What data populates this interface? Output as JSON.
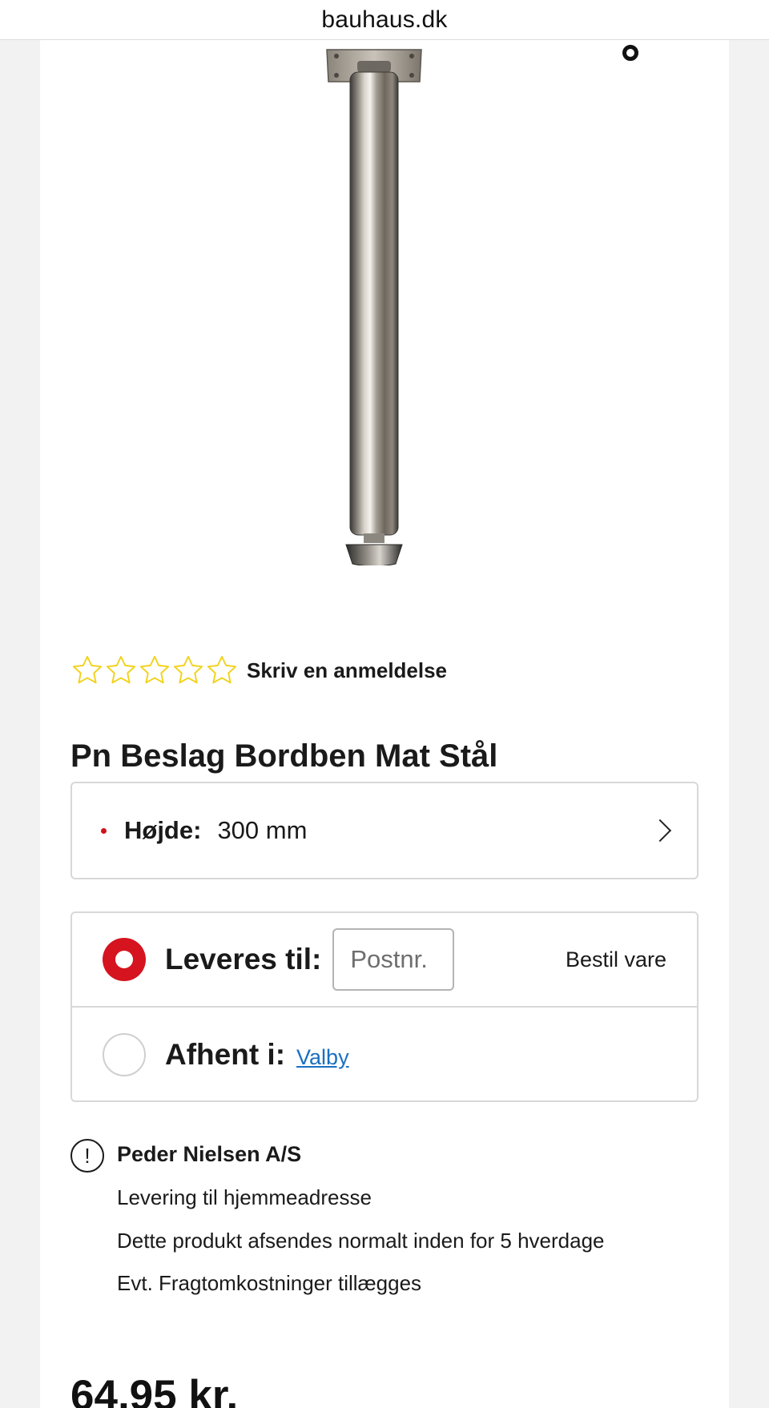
{
  "browser": {
    "url": "bauhaus.dk"
  },
  "product": {
    "image_alt": "Pn Beslag Bordben Mat Stål",
    "rating": {
      "stars_filled": 0,
      "stars_total": 5,
      "review_link": "Skriv en anmeldelse"
    },
    "title": "Pn Beslag Bordben Mat Stål",
    "option": {
      "label": "Højde:",
      "value": "300 mm"
    },
    "delivery": {
      "deliver_label": "Leveres til:",
      "postcode_placeholder": "Postnr.",
      "order_label": "Bestil vare",
      "pickup_label": "Afhent i:",
      "pickup_store": "Valby"
    },
    "seller": {
      "name": "Peder Nielsen A/S",
      "lines": [
        "Levering til hjemmeadresse",
        "Dette produkt afsendes normalt inden for 5 hverdage",
        "Evt. Fragtomkostninger tillægges"
      ]
    },
    "price": "64,95 kr."
  },
  "colors": {
    "accent_red": "#d5141f",
    "star_yellow": "#f2d21b",
    "link_blue": "#1a6fc2"
  }
}
